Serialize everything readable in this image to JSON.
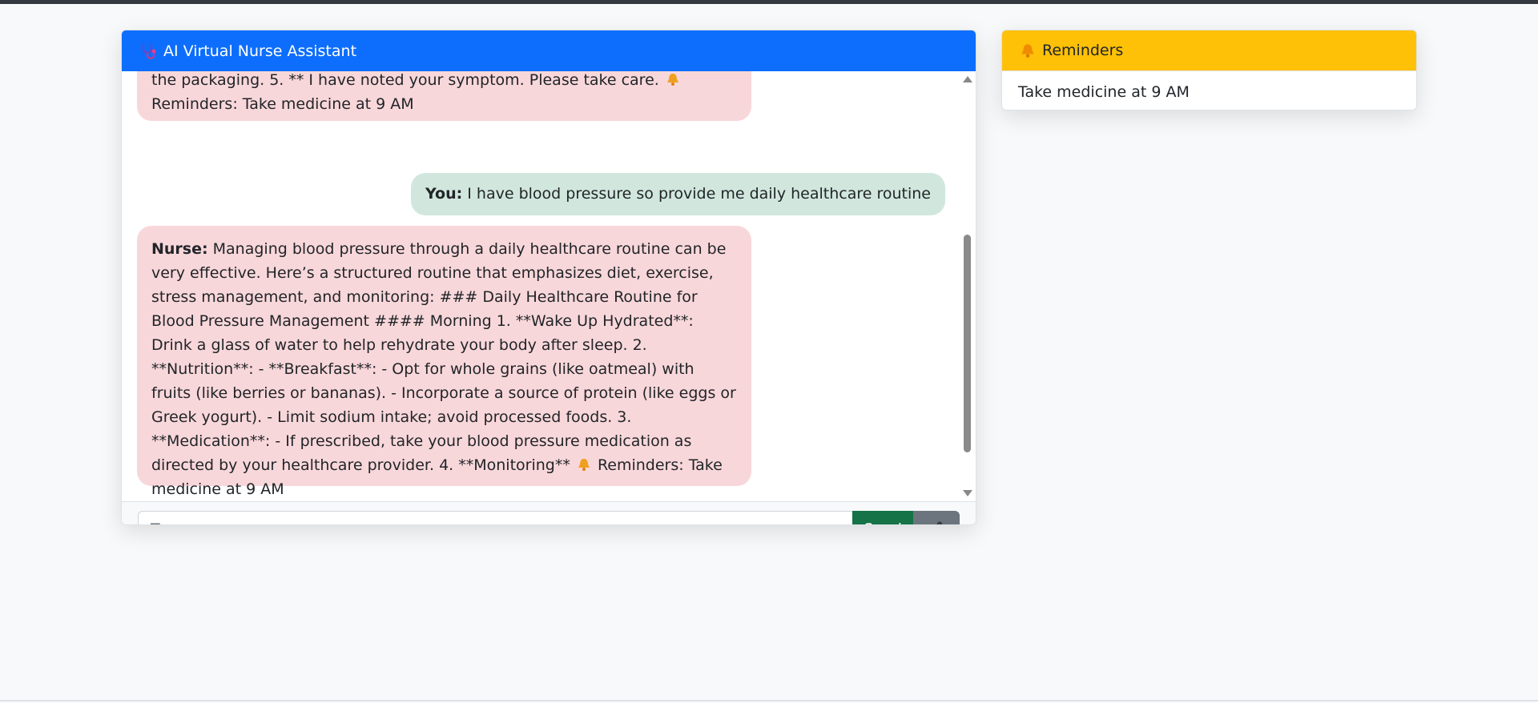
{
  "chat": {
    "title": "AI Virtual Nurse Assistant",
    "messages": [
      {
        "role": "nurse",
        "partial_line": "the packaging. 5. ** I have noted your symptom. Please take care.",
        "reminder_text": "Reminders: Take medicine at 9 AM"
      },
      {
        "role": "user",
        "sender": "You:",
        "text": "I have blood pressure so provide me daily healthcare routine"
      },
      {
        "role": "nurse",
        "sender": "Nurse:",
        "text": "Managing blood pressure through a daily healthcare routine can be very effective. Here’s a structured routine that emphasizes diet, exercise, stress management, and monitoring: ### Daily Healthcare Routine for Blood Pressure Management #### Morning 1. **Wake Up Hydrated**: Drink a glass of water to help rehydrate your body after sleep. 2. **Nutrition**: - **Breakfast**: - Opt for whole grains (like oatmeal) with fruits (like berries or bananas). - Incorporate a source of protein (like eggs or Greek yogurt). - Limit sodium intake; avoid processed foods. 3. **Medication**: - If prescribed, take your blood pressure medication as directed by your healthcare provider. 4. **Monitoring**",
        "reminder_text": "Reminders: Take medicine at 9 AM"
      }
    ],
    "input": {
      "value": "",
      "placeholder": "Type your message..."
    },
    "send_label": "Send",
    "icons": {
      "header": "stethoscope-icon",
      "mic": "microphone-icon",
      "reminder": "bell-icon"
    }
  },
  "reminders": {
    "title": "Reminders",
    "items": [
      "Take medicine at 9 AM"
    ]
  },
  "colors": {
    "header_blue": "#0d6efd",
    "nurse_bubble": "#f8d7da",
    "user_bubble": "#d1e7dd",
    "send_green": "#157347",
    "mic_gray": "#6c757d",
    "reminder_yellow": "#ffc107"
  }
}
